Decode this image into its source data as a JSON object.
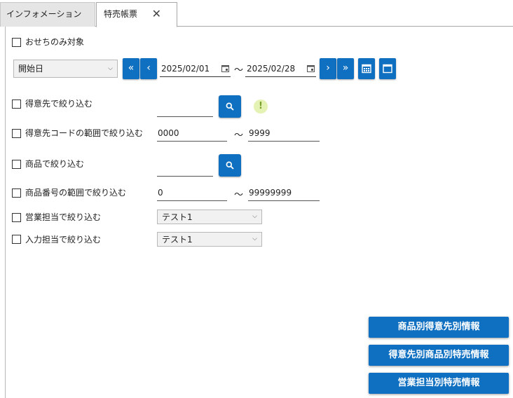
{
  "tabs": [
    {
      "label": "インフォメーション"
    },
    {
      "label": "特売帳票",
      "close": "✕"
    }
  ],
  "osechi": {
    "label": "おせちのみ対象"
  },
  "date_range": {
    "type_select": "開始日",
    "from": "2025/02/01",
    "to": "2025/02/28",
    "separator": "〜"
  },
  "filters": {
    "customer": {
      "label": "得意先で絞り込む",
      "value": ""
    },
    "customer_code_range": {
      "label": "得意先コードの範囲で絞り込む",
      "from": "0000",
      "to": "9999",
      "separator": "〜"
    },
    "product": {
      "label": "商品で絞り込む",
      "value": ""
    },
    "product_number_range": {
      "label": "商品番号の範囲で絞り込む",
      "from": "0",
      "to": "99999999",
      "separator": "〜"
    },
    "sales_rep": {
      "label": "営業担当で絞り込む",
      "selected": "テスト1"
    },
    "input_rep": {
      "label": "入力担当で絞り込む",
      "selected": "テスト1"
    }
  },
  "warning": {
    "symbol": "!"
  },
  "actions": [
    {
      "label": "商品別得意先別情報"
    },
    {
      "label": "得意先別商品別特売情報"
    },
    {
      "label": "営業担当別特売情報"
    }
  ],
  "colors": {
    "accent": "#0f6fc0"
  }
}
